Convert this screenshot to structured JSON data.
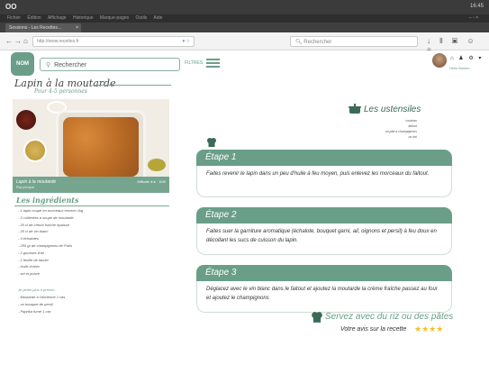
{
  "os": {
    "logo": "OO",
    "clock": "16:45"
  },
  "browser": {
    "menu": [
      "Fichier",
      "Édition",
      "Affichage",
      "Historique",
      "Marque-pages",
      "Outils",
      "Aide"
    ],
    "tab_title": "Sessions - Les Recettes...",
    "url": "http://www.recettes.fr",
    "search_placeholder": "Rechercher",
    "toolbar_icons": "↓ ⫴ ▣ ☺ ≡"
  },
  "site": {
    "logo": "NOM",
    "search_placeholder": "Rechercher",
    "filter_label": "FILTRES",
    "user_name": "Hello Marion",
    "header_icons": "⌂ ♟ ⚙ ▾"
  },
  "recipe": {
    "title": "Lapin à la moutarde",
    "servings": "Pour 4-5 personnes",
    "photo_caption": {
      "title": "Lapin à la moutarde",
      "subtitle": "Plat principal",
      "right": "Difficulté ★★ · 1h30"
    },
    "ingredients_title": "Les ingrédients",
    "ingredients": [
      "- 1 lapin coupé en morceaux environ 1kg",
      "- 3 cuillerées à soupe de moutarde",
      "- 20 cl de crème fraîche épaisse",
      "- 25 cl de vin blanc",
      "- 3 échalotes",
      "- 250 gr de champignons de Paris",
      "- 2 gousses d'ail",
      "- 1 feuille de laurier",
      "- Huile d'olive",
      "- sel et poivre"
    ],
    "side_title": "Je petite plus à prévoir :",
    "sides": [
      "- Moutarde à l'ancienne 1 càs",
      "- un bouquet de persil",
      "- Paprika fumé 1 càc"
    ],
    "utensils_title": "Les ustensiles",
    "utensils": [
      "couteau",
      "faitout",
      "un plat à champignons",
      "un bol"
    ],
    "steps": [
      {
        "label": "Étape 1",
        "text": "Faites revenir le lapin dans un peu d'huile à feu moyen, puis enlevez les morceaux du faitout."
      },
      {
        "label": "Étape 2",
        "text": "Faites suer la garniture aromatique (échalote, bouquet garni, ail, oignons et persil) à feu doux en décollant les sucs de cuisson du lapin."
      },
      {
        "label": "Étape 3",
        "text": "Déglacez avec le vin blanc dans le faitout et ajoutez la moutarde la crème fraîche passez au four et ajoutez le champignons"
      }
    ],
    "serve_text": "Servez avec du riz ou des pâtes",
    "review_label": "Votre avis sur la recette",
    "stars": "★★★★"
  },
  "colors": {
    "accent": "#6a9e88",
    "dark_accent": "#3a6b57",
    "stars": "#f2c12e"
  }
}
